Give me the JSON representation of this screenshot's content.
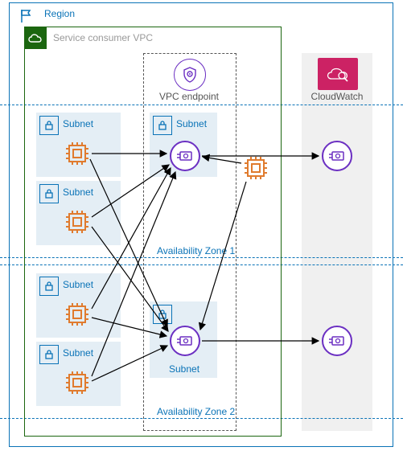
{
  "region": {
    "label": "Region"
  },
  "vpc": {
    "label": "Service consumer VPC"
  },
  "endpoint": {
    "label": "VPC endpoint"
  },
  "cloudwatch": {
    "label": "CloudWatch"
  },
  "az1": {
    "label": "Availability Zone 1"
  },
  "az2": {
    "label": "Availability Zone 2"
  },
  "subnet_label": "Subnet",
  "icons": {
    "flag": "region-flag-icon",
    "cloud": "vpc-cloud-icon",
    "shield": "endpoint-shield-icon",
    "cloudwatch": "cloudwatch-magnifier-icon",
    "lock": "private-lock-icon",
    "chip": "ec2-instance-icon",
    "eni": "network-interface-icon"
  },
  "colors": {
    "region": "#0a73b7",
    "vpc": "#1b660f",
    "endpoint": "#6b2fc2",
    "cloudwatch": "#cc2264",
    "chip": "#e07b2e",
    "subnet_bg": "#e4eef5"
  }
}
